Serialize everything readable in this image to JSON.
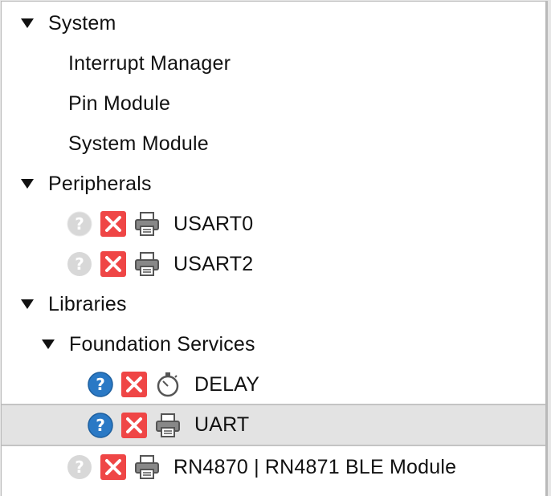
{
  "tree": {
    "system": {
      "label": "System",
      "children": [
        "Interrupt Manager",
        "Pin Module",
        "System Module"
      ]
    },
    "peripherals": {
      "label": "Peripherals",
      "children": [
        {
          "label": "USART0",
          "help_icon": "help-disabled",
          "status_icon": "error-x",
          "type_icon": "printer"
        },
        {
          "label": "USART2",
          "help_icon": "help-disabled",
          "status_icon": "error-x",
          "type_icon": "printer"
        }
      ]
    },
    "libraries": {
      "label": "Libraries",
      "foundation_services": {
        "label": "Foundation Services",
        "children": [
          {
            "label": "DELAY",
            "help_icon": "help-active",
            "status_icon": "error-x",
            "type_icon": "stopwatch"
          },
          {
            "label": "UART",
            "help_icon": "help-active",
            "status_icon": "error-x",
            "type_icon": "printer",
            "selected": true
          }
        ]
      },
      "children": [
        {
          "label": "RN4870 | RN4871 BLE Module",
          "help_icon": "help-disabled",
          "status_icon": "error-x",
          "type_icon": "printer"
        }
      ]
    }
  },
  "colors": {
    "help_active": "#2a79c5",
    "help_disabled": "#d6d6d6",
    "error_red": "#ef4646",
    "selection_bg": "#e3e3e3"
  }
}
